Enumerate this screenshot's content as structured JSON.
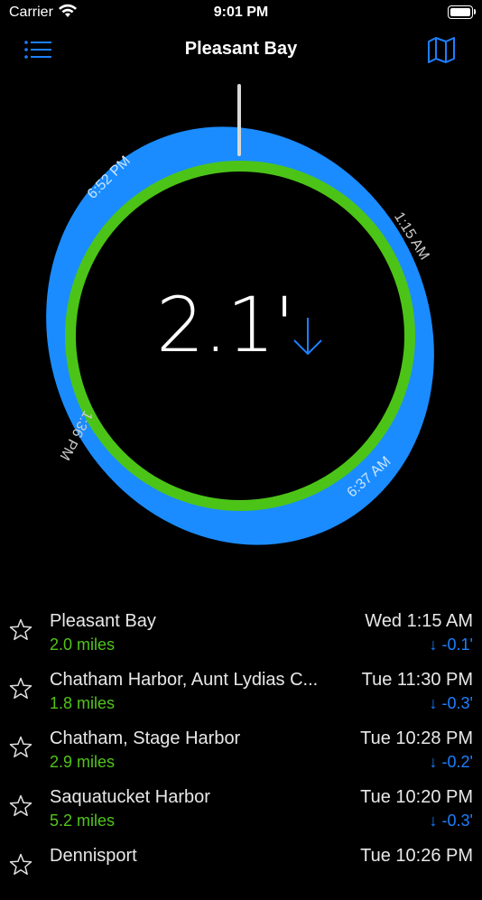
{
  "status": {
    "carrier": "Carrier",
    "time": "9:01 PM"
  },
  "nav": {
    "title": "Pleasant Bay"
  },
  "dial": {
    "height": "2.1'",
    "labels": {
      "top_left": "6:52 PM",
      "top_right": "1:15 AM",
      "bottom_left": "1:36 PM",
      "bottom_right": "6:37 AM"
    },
    "colors": {
      "outer": "#1a8cff",
      "inner": "#4cc417"
    }
  },
  "stations": [
    {
      "name": "Pleasant Bay",
      "distance": "2.0 miles",
      "time": "Wed 1:15 AM",
      "change": "↓ -0.1'"
    },
    {
      "name": "Chatham Harbor, Aunt Lydias C...",
      "distance": "1.8 miles",
      "time": "Tue 11:30 PM",
      "change": "↓ -0.3'"
    },
    {
      "name": "Chatham, Stage Harbor",
      "distance": "2.9 miles",
      "time": "Tue 10:28 PM",
      "change": "↓ -0.2'"
    },
    {
      "name": "Saquatucket Harbor",
      "distance": "5.2 miles",
      "time": "Tue 10:20 PM",
      "change": "↓ -0.3'"
    },
    {
      "name": "Dennisport",
      "distance": "",
      "time": "Tue 10:26 PM",
      "change": ""
    }
  ]
}
